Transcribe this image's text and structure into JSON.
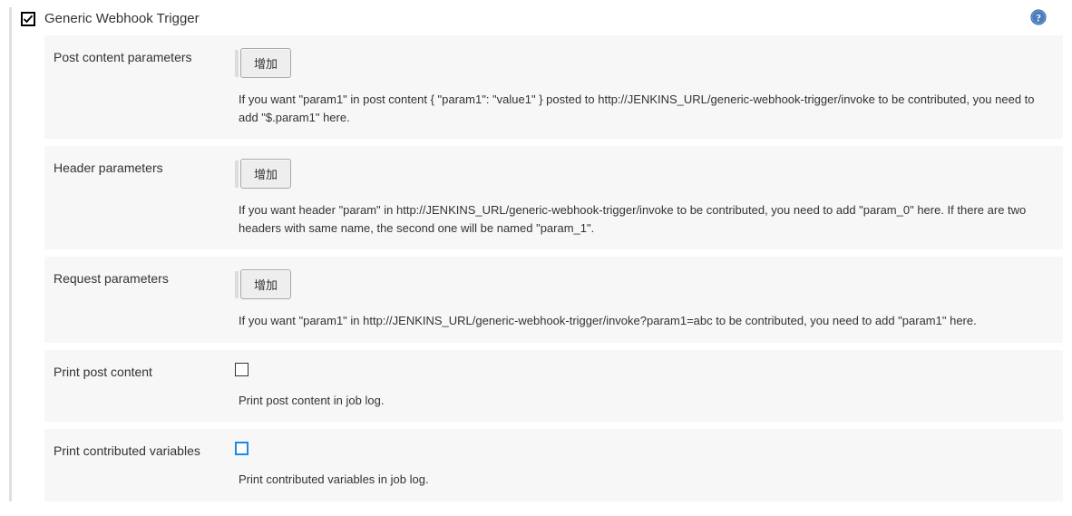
{
  "plugin": {
    "title": "Generic Webhook Trigger",
    "checked": true
  },
  "sections": {
    "post_content": {
      "label": "Post content parameters",
      "button_label": "增加",
      "description": "If you want \"param1\" in post content { \"param1\": \"value1\" } posted to http://JENKINS_URL/generic-webhook-trigger/invoke to be contributed, you need to add \"$.param1\" here."
    },
    "header": {
      "label": "Header parameters",
      "button_label": "增加",
      "description": "If you want header \"param\" in http://JENKINS_URL/generic-webhook-trigger/invoke to be contributed, you need to add \"param_0\" here. If there are two headers with same name, the second one will be named \"param_1\"."
    },
    "request": {
      "label": "Request parameters",
      "button_label": "增加",
      "description": "If you want \"param1\" in http://JENKINS_URL/generic-webhook-trigger/invoke?param1=abc to be contributed, you need to add \"param1\" here."
    },
    "print_post": {
      "label": "Print post content",
      "description": "Print post content in job log."
    },
    "print_vars": {
      "label": "Print contributed variables",
      "description": "Print contributed variables in job log."
    }
  }
}
